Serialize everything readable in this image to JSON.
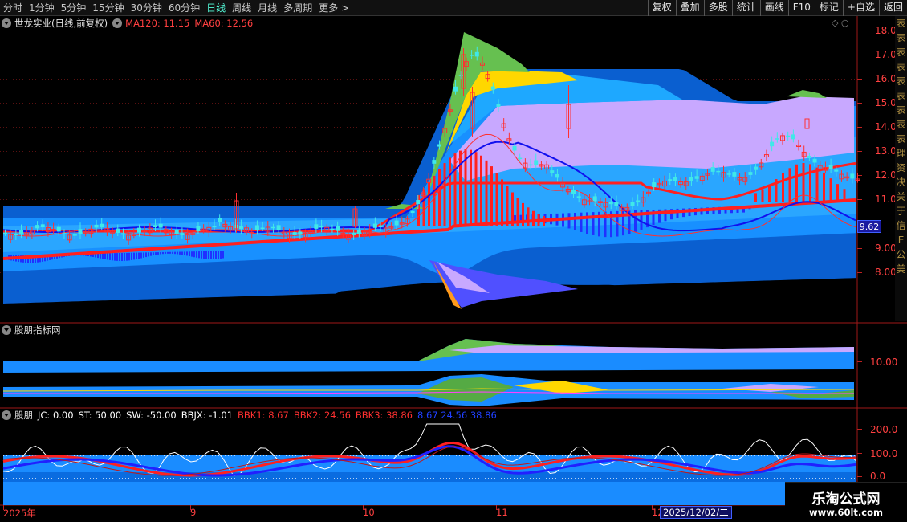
{
  "toolbar": {
    "periods": [
      "分时",
      "1分钟",
      "5分钟",
      "15分钟",
      "30分钟",
      "60分钟",
      "日线",
      "周线",
      "月线",
      "多周期",
      "更多 >"
    ],
    "active_period": "日线",
    "tools": [
      "复权",
      "叠加",
      "多股",
      "统计",
      "画线",
      "F10",
      "标记",
      "+自选",
      "返回"
    ]
  },
  "main_pane": {
    "stock_title": "世龙实业(日线,前复权)",
    "ma120": "MA120: 11.15",
    "ma60": "MA60: 12.56",
    "current_price": "9.62",
    "price_axis": [
      "18.00",
      "17.00",
      "16.00",
      "15.00",
      "14.00",
      "13.00",
      "12.00",
      "11.00",
      "9.00",
      "8.00"
    ]
  },
  "pane2": {
    "title": "股朋指标网",
    "axis": [
      "10.00"
    ]
  },
  "pane3": {
    "name": "股朋",
    "jc": "JC: 0.00",
    "st": "ST: 50.00",
    "sw": "SW: -50.00",
    "bbjx": "BBJX: -1.01",
    "bbk1": "BBK1: 8.67",
    "bbk2": "BBK2: 24.56",
    "bbk3": "BBK3: 38.86",
    "extra": "8.67  24.56  38.86",
    "axis": [
      "200.0",
      "100.0",
      "0.0"
    ]
  },
  "date_axis": [
    "2025年",
    "9",
    "10",
    "11",
    "12"
  ],
  "cursor_date": "2025/12/02/二",
  "side_strip": [
    "表",
    "表",
    "表",
    "表",
    "表",
    "表",
    "表",
    "表",
    "表",
    "理",
    "资",
    "决",
    "关",
    "于",
    "信",
    "E",
    "公",
    "美"
  ],
  "watermark": {
    "title": "乐淘公式网",
    "url": "www.60lt.com"
  },
  "colors": {
    "up": "#ff3030",
    "down": "#40e8e8",
    "ma_red": "#ff2020",
    "ma_blue": "#2020ff",
    "band_blue": "#0a7fe0",
    "band_light": "#1aa0ff",
    "band_purple": "#c8a0ff",
    "band_yellow": "#ffd700",
    "band_green": "#66cc55",
    "axis_red": "#ff4040"
  }
}
